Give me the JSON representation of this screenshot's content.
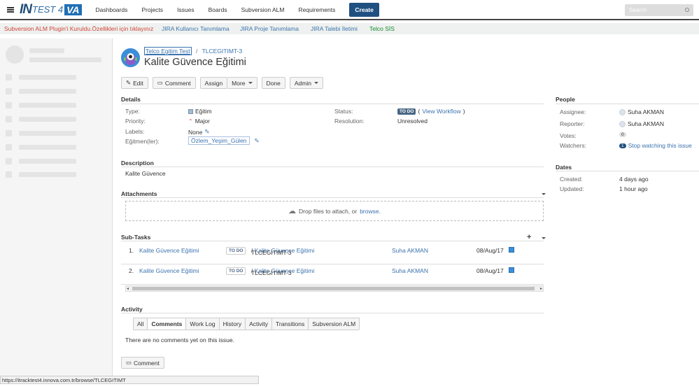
{
  "nav": {
    "logo_in": "IN",
    "logo_test": "TEST 4",
    "logo_va": "VA",
    "items": [
      "Dashboards",
      "Projects",
      "Issues",
      "Boards",
      "Subversion ALM",
      "Requirements"
    ],
    "create_label": "Create",
    "search_placeholder": "Search"
  },
  "banner": {
    "alert": "Subversion ALM Plugin'i Kuruldu.Özellikleri için tıklayınız",
    "links": [
      "JIRA Kullanıcı Tanımlama",
      "JIRA Proje Tanımlama",
      "JIRA Talebi İletimi",
      "Telco SİS"
    ]
  },
  "issue": {
    "project": "Telco Egitim Test",
    "key": "TLCEGITIMT-3",
    "title": "Kalite Güvence Eğitimi",
    "toolbar": {
      "edit": "Edit",
      "comment": "Comment",
      "assign": "Assign",
      "more": "More",
      "done": "Done",
      "admin": "Admin"
    },
    "details": {
      "heading": "Details",
      "type_label": "Type:",
      "type_value": "Eğitim",
      "priority_label": "Priority:",
      "priority_value": "Major",
      "labels_label": "Labels:",
      "labels_value": "None",
      "trainers_label": "Eğitmen(ler):",
      "trainers_value": "Özlem_Yeşim_Gülen",
      "status_label": "Status:",
      "status_value": "TO DO",
      "view_workflow": "View Workflow",
      "resolution_label": "Resolution:",
      "resolution_value": "Unresolved"
    },
    "description": {
      "heading": "Description",
      "text": "Kalite Güvence"
    },
    "attachments": {
      "heading": "Attachments",
      "drop_text": "Drop files to attach, or",
      "browse": "browse."
    },
    "subtasks": {
      "heading": "Sub-Tasks",
      "rows": [
        {
          "num": "1.",
          "summary": "Kalite Güvence Eğitimi",
          "status": "TO DO",
          "parent_key": "TLCEGITIMT-3",
          "parent_summary": "Kalite Güvence Eğitimi",
          "assignee": "Suha AKMAN",
          "date": "08/Aug/17"
        },
        {
          "num": "2.",
          "summary": "Kalite Güvence Eğitimi",
          "status": "TO DO",
          "parent_key": "TLCEGITIMT-3",
          "parent_summary": "Kalite Güvence Eğitimi",
          "assignee": "Suha AKMAN",
          "date": "08/Aug/17"
        }
      ]
    },
    "activity": {
      "heading": "Activity",
      "tabs": [
        "All",
        "Comments",
        "Work Log",
        "History",
        "Activity",
        "Transitions",
        "Subversion ALM"
      ],
      "active_tab": "Comments",
      "empty_text": "There are no comments yet on this issue.",
      "comment_button": "Comment"
    }
  },
  "people": {
    "heading": "People",
    "assignee_label": "Assignee:",
    "assignee": "Suha AKMAN",
    "reporter_label": "Reporter:",
    "reporter": "Suha AKMAN",
    "votes_label": "Votes:",
    "votes": "0",
    "watchers_label": "Watchers:",
    "watchers": "1",
    "stop_watching": "Stop watching this issue"
  },
  "dates": {
    "heading": "Dates",
    "created_label": "Created:",
    "created": "4 days ago",
    "updated_label": "Updated:",
    "updated": "1 hour ago"
  },
  "status_bar": {
    "url": "https://itracktest4.innova.com.tr/browse/TLCEGITIMT"
  },
  "colors": {
    "primary": "#205081",
    "link": "#3b73af",
    "alert_red": "#d04437",
    "banner_link": "#3b73af",
    "banner_green": "#14892c"
  }
}
